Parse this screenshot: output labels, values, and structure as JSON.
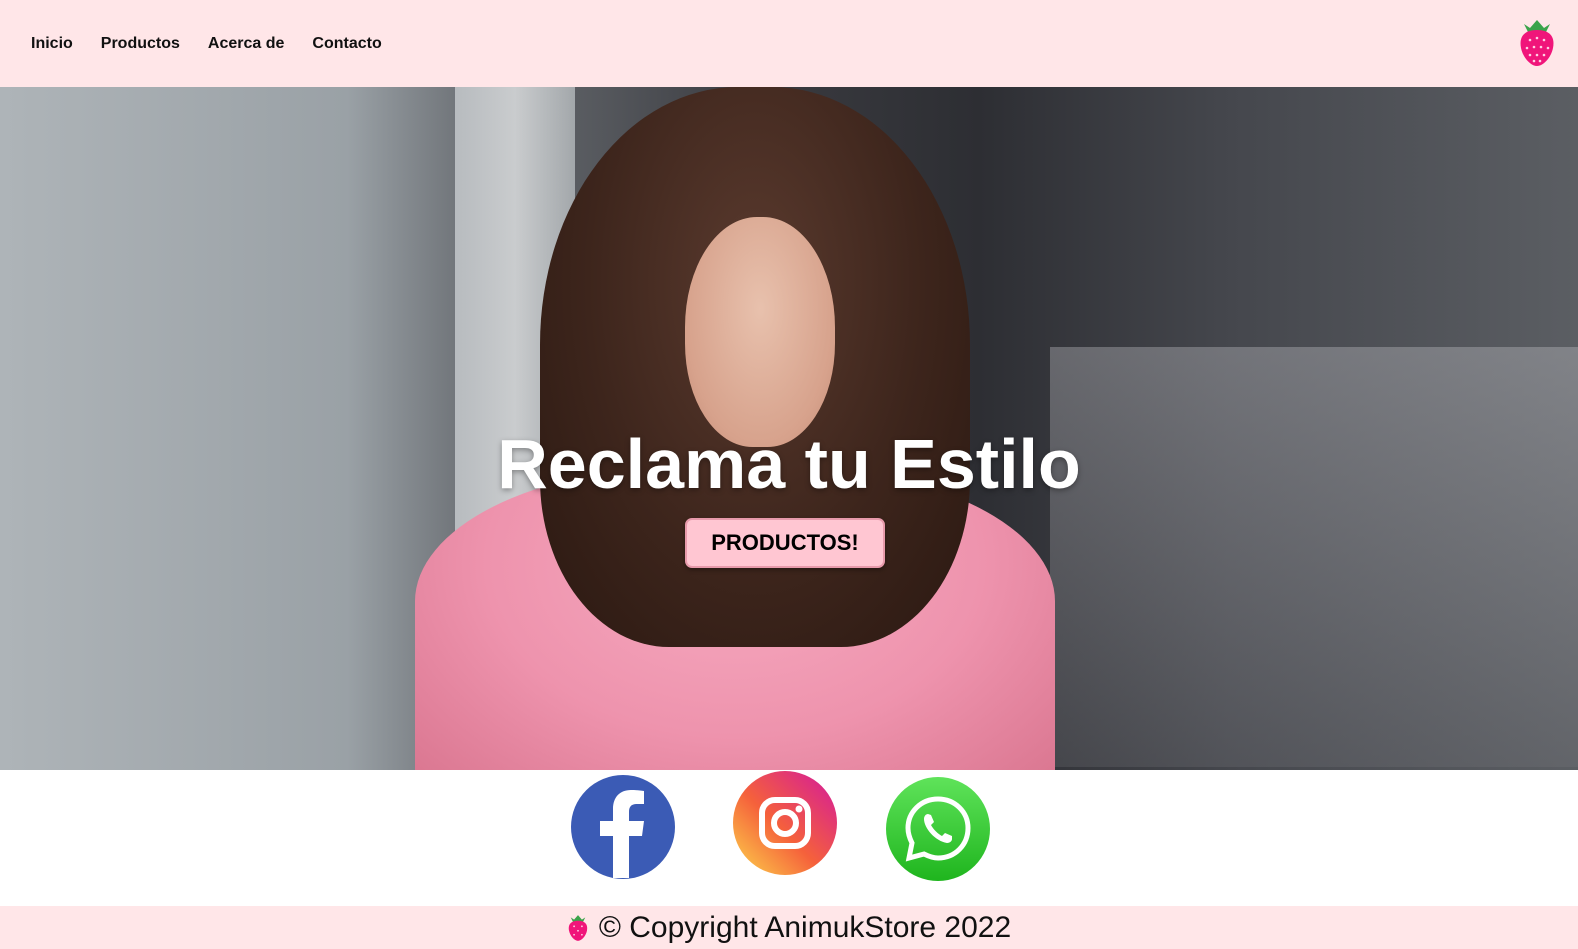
{
  "nav": {
    "items": [
      {
        "label": "Inicio"
      },
      {
        "label": "Productos"
      },
      {
        "label": "Acerca de"
      },
      {
        "label": "Contacto"
      }
    ],
    "logo_icon": "strawberry-icon",
    "bg_color": "#ffe6e8"
  },
  "hero": {
    "title": "Reclama tu Estilo",
    "button_label": "PRODUCTOS!",
    "button_color": "#ffc6d2"
  },
  "social": {
    "icons": [
      "facebook-icon",
      "instagram-icon",
      "whatsapp-icon"
    ]
  },
  "footer": {
    "logo_icon": "strawberry-icon",
    "text": "© Copyright AnimukStore 2022"
  }
}
